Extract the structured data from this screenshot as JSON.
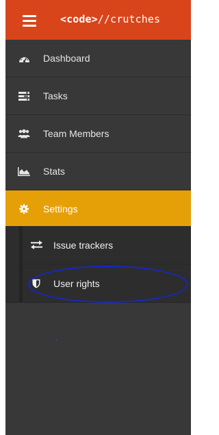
{
  "header": {
    "brand_tag": "<code>",
    "brand_path": "//crutches",
    "bg_color": "#d9451b"
  },
  "nav": {
    "items": [
      {
        "label": "Dashboard",
        "icon": "dashboard-gauge-icon"
      },
      {
        "label": "Tasks",
        "icon": "tasks-list-icon"
      },
      {
        "label": "Team Members",
        "icon": "team-members-icon"
      },
      {
        "label": "Stats",
        "icon": "area-chart-icon"
      },
      {
        "label": "Settings",
        "icon": "gear-icon",
        "active": true
      }
    ],
    "active_color": "#e6a007"
  },
  "settings_submenu": {
    "items": [
      {
        "label": "Issue trackers",
        "icon": "exchange-arrows-icon"
      },
      {
        "label": "User rights",
        "icon": "shield-icon"
      }
    ]
  },
  "annotation": {
    "color": "#1428c8"
  }
}
